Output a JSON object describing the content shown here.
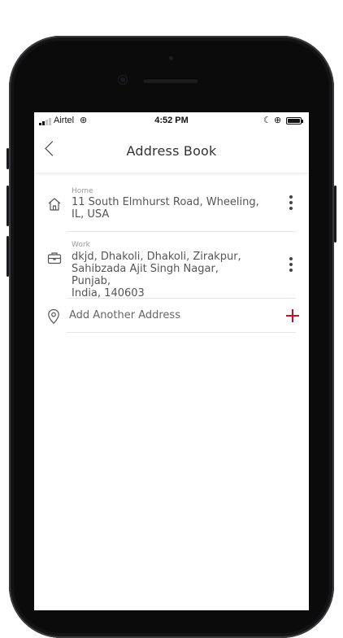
{
  "status_bar": {
    "carrier": "Airtel",
    "time": "4:52 PM",
    "wifi_icon": "⊛",
    "moon_icon": "☾",
    "lock_icon": "⊕"
  },
  "header": {
    "title": "Address Book"
  },
  "addresses": [
    {
      "label": "Home",
      "lines": [
        "11 South Elmhurst Road, Wheeling,",
        "IL, USA"
      ],
      "icon": "home-icon"
    },
    {
      "label": "Work",
      "lines": [
        "dkjd, Dhakoli, Dhakoli, Zirakpur,",
        "Sahibzada Ajit Singh Nagar, Punjab,",
        "India, 140603"
      ],
      "icon": "briefcase-icon"
    }
  ],
  "add_address": {
    "label": "Add Another Address",
    "icon": "location-pin-icon",
    "accent": "#c8102e"
  }
}
